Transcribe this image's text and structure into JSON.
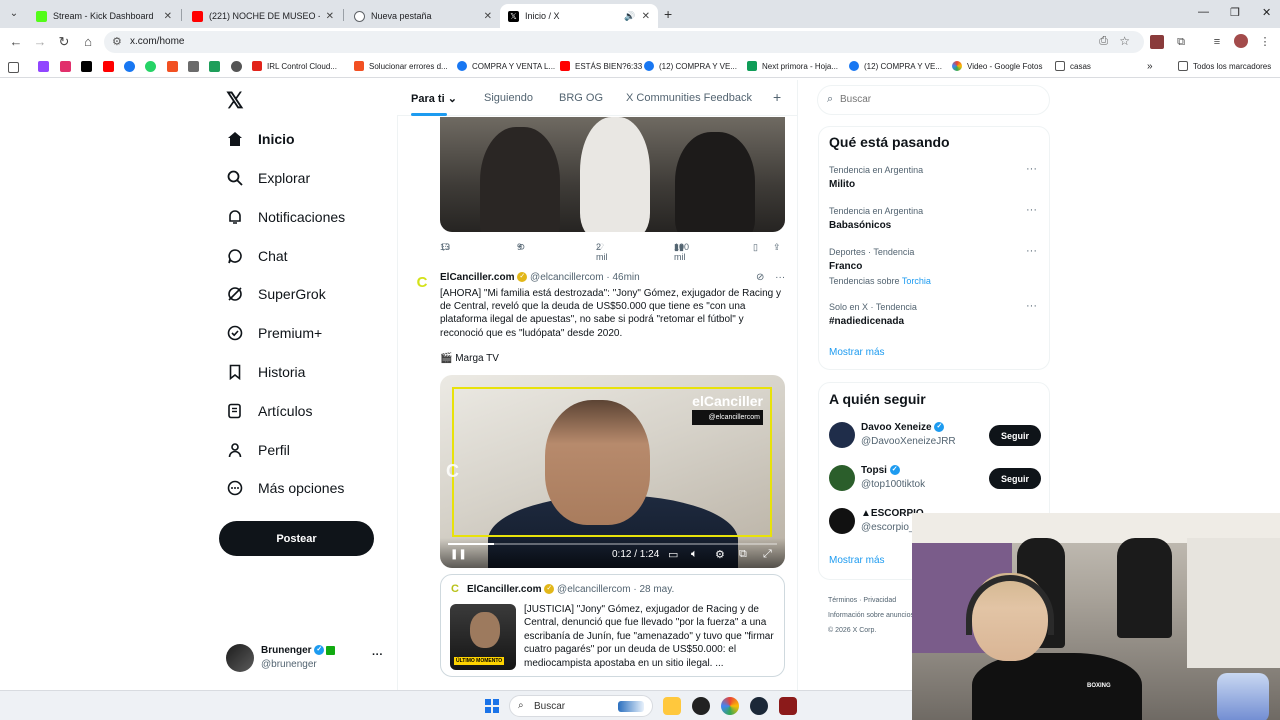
{
  "browser": {
    "tabs": [
      {
        "title": "Stream - Kick Dashboard",
        "color": "#53fc18"
      },
      {
        "title": "(221) NOCHE DE MUSEO - Yacu",
        "color": "#ff0000"
      },
      {
        "title": "Nueva pestaña",
        "color": "#5f6368"
      },
      {
        "title": "Inicio / X",
        "color": "#000000",
        "active": true
      }
    ],
    "url": "x.com/home",
    "bookmarks": [
      "IRL Control Cloud...",
      "Solucionar errores d...",
      "COMPRA Y VENTA L...",
      "ESTÁS BIEN?6:33",
      "(12) COMPRA Y VE...",
      "Next primora - Hoja...",
      "(12) COMPRA Y VE...",
      "Video - Google Fotos",
      "casas"
    ],
    "all_bookmarks": "Todos los marcadores"
  },
  "nav": {
    "items": [
      {
        "label": "Inicio",
        "icon": "home-icon"
      },
      {
        "label": "Explorar",
        "icon": "search-icon"
      },
      {
        "label": "Notificaciones",
        "icon": "bell-icon"
      },
      {
        "label": "Chat",
        "icon": "chat-icon"
      },
      {
        "label": "SuperGrok",
        "icon": "grok-icon"
      },
      {
        "label": "Premium+",
        "icon": "verified-badge-icon"
      },
      {
        "label": "Historia",
        "icon": "bookmark-icon"
      },
      {
        "label": "Artículos",
        "icon": "article-icon"
      },
      {
        "label": "Perfil",
        "icon": "person-icon"
      },
      {
        "label": "Más opciones",
        "icon": "more-circle-icon"
      }
    ],
    "post_label": "Postear",
    "account": {
      "name": "Brunenger",
      "handle": "@brunenger"
    }
  },
  "timeline": {
    "tabs": [
      "Para ti",
      "Siguiendo",
      "BRG OG",
      "X Communities Feedback"
    ],
    "prev_actions": {
      "replies": "13",
      "reposts": "9",
      "likes": "2 mil",
      "views": "100 mil"
    },
    "tweet": {
      "name": "ElCanciller.com",
      "handle": "@elcancillercom",
      "time": "· 46min",
      "text": "[AHORA] \"Mi familia está destrozada\": \"Jony\" Gómez, exjugador de Racing y de Central, reveló que la deuda de US$50.000 que tiene es \"con una plataforma ilegal de apuestas\", no sabe si podrá \"retomar el fútbol\" y reconoció que es \"ludópata\" desde 2020.",
      "source": "🎬 Marga TV",
      "video": {
        "brand": "elCanciller",
        "brand_handle": "@elcancillercom",
        "watermark": "C",
        "time": "0:12 / 1:24",
        "progress": 0.14
      },
      "quote": {
        "name": "ElCanciller.com",
        "handle": "@elcancillercom",
        "time": "· 28 may.",
        "thumb_label": "ÚLTIMO MOMENTO",
        "text": "[JUSTICIA] \"Jony\" Gómez, exjugador de Racing y de Central, denunció que fue llevado \"por la fuerza\" a una escribanía de Junín, fue \"amenazado\" y tuvo que \"firmar cuatro pagarés\" por un deuda de US$50.000: el mediocampista apostaba en un sitio ilegal.  ..."
      }
    }
  },
  "sidebar": {
    "search_placeholder": "Buscar",
    "trends_title": "Qué está pasando",
    "trends": [
      {
        "context": "Tendencia en Argentina",
        "name": "Milito",
        "sub": ""
      },
      {
        "context": "Tendencia en Argentina",
        "name": "Babasónicos",
        "sub": ""
      },
      {
        "context": "Deportes · Tendencia",
        "name": "Franco",
        "sub": "Tendencias sobre",
        "sub_link": "Torchia"
      },
      {
        "context": "Solo en X · Tendencia",
        "name": "#nadiedicenada",
        "sub": ""
      }
    ],
    "show_more": "Mostrar más",
    "who_title": "A quién seguir",
    "who": [
      {
        "name": "Davoo Xeneize",
        "handle": "@DavooXeneizeJRR",
        "follow": "Seguir",
        "avatar_color": "#1f2d4a"
      },
      {
        "name": "Topsi",
        "handle": "@top100tiktok",
        "follow": "Seguir",
        "avatar_color": "#2b5e2b"
      },
      {
        "name": "▲ESCORPIO",
        "handle": "@escorpio_",
        "follow": "",
        "avatar_color": "#111111"
      }
    ],
    "footer": [
      "Términos",
      "Privacidad",
      "Información sobre anuncios",
      "© 2026 X Corp."
    ]
  },
  "taskbar": {
    "search": "Buscar"
  }
}
